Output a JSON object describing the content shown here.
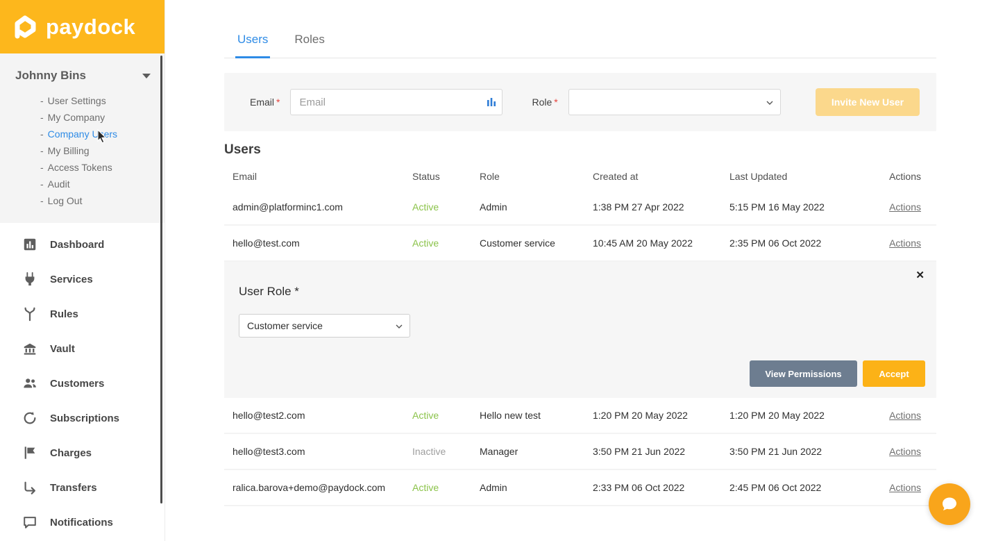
{
  "colors": {
    "brand_yellow": "#FDB71C",
    "accent_blue": "#2E8BE6",
    "status_active": "#8BC34A",
    "status_inactive": "#9E9E9E",
    "view_permissions_button": "#6D7D90",
    "accept_button": "#FCB217"
  },
  "brand": {
    "name": "paydock"
  },
  "sidebar": {
    "bullet": "-",
    "account": {
      "name": "Johnny Bins"
    },
    "account_links": [
      {
        "label": "User Settings"
      },
      {
        "label": "My Company"
      },
      {
        "label": "Company Users",
        "active": true
      },
      {
        "label": "My Billing"
      },
      {
        "label": "Access Tokens"
      },
      {
        "label": "Audit"
      },
      {
        "label": "Log Out"
      }
    ],
    "nav": [
      {
        "label": "Dashboard",
        "icon": "bar-chart-icon"
      },
      {
        "label": "Services",
        "icon": "plug-icon"
      },
      {
        "label": "Rules",
        "icon": "branch-icon"
      },
      {
        "label": "Vault",
        "icon": "bank-icon"
      },
      {
        "label": "Customers",
        "icon": "people-icon"
      },
      {
        "label": "Subscriptions",
        "icon": "refresh-icon"
      },
      {
        "label": "Charges",
        "icon": "flag-icon"
      },
      {
        "label": "Transfers",
        "icon": "arrow-turn-icon"
      },
      {
        "label": "Notifications",
        "icon": "chat-icon"
      }
    ]
  },
  "tabs": [
    {
      "label": "Users",
      "active": true
    },
    {
      "label": "Roles",
      "active": false
    }
  ],
  "invite_form": {
    "email_label": "Email",
    "required_mark": "*",
    "email_placeholder": "Email",
    "email_value": "",
    "role_label": "Role",
    "role_value": "",
    "invite_button": "Invite New User"
  },
  "users_section": {
    "title": "Users",
    "columns": [
      "Email",
      "Status",
      "Role",
      "Created at",
      "Last Updated",
      "Actions"
    ],
    "rows": [
      {
        "email": "admin@platforminc1.com",
        "status": "Active",
        "role": "Admin",
        "created_at": "1:38 PM 27 Apr 2022",
        "last_updated": "5:15 PM 16 May 2022",
        "actions": "Actions"
      },
      {
        "email": "hello@test.com",
        "status": "Active",
        "role": "Customer service",
        "created_at": "10:45 AM 20 May 2022",
        "last_updated": "2:35 PM 06 Oct 2022",
        "actions": "Actions"
      },
      {
        "email": "hello@test2.com",
        "status": "Active",
        "role": "Hello new test",
        "created_at": "1:20 PM 20 May 2022",
        "last_updated": "1:20 PM 20 May 2022",
        "actions": "Actions"
      },
      {
        "email": "hello@test3.com",
        "status": "Inactive",
        "role": "Manager",
        "created_at": "3:50 PM 21 Jun 2022",
        "last_updated": "3:50 PM 21 Jun 2022",
        "actions": "Actions"
      },
      {
        "email": "ralica.barova+demo@paydock.com",
        "status": "Active",
        "role": "Admin",
        "created_at": "2:33 PM 06 Oct 2022",
        "last_updated": "2:45 PM 06 Oct 2022",
        "actions": "Actions"
      }
    ]
  },
  "edit_panel": {
    "title": "User Role *",
    "selected_role": "Customer service",
    "view_permissions_button": "View Permissions",
    "accept_button": "Accept",
    "close_icon": "✕"
  }
}
